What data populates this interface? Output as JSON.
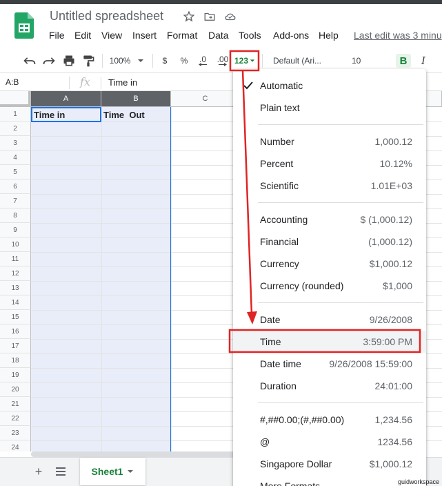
{
  "doc": {
    "title": "Untitled spreadsheet",
    "last_edit": "Last edit was 3 minu"
  },
  "menubar": [
    {
      "label": "File"
    },
    {
      "label": "Edit"
    },
    {
      "label": "View"
    },
    {
      "label": "Insert"
    },
    {
      "label": "Format"
    },
    {
      "label": "Data"
    },
    {
      "label": "Tools"
    },
    {
      "label": "Add-ons"
    },
    {
      "label": "Help"
    }
  ],
  "toolbar": {
    "zoom": "100%",
    "currency": "$",
    "percent": "%",
    "dec_decrease": ".0",
    "dec_increase": ".00",
    "more_formats": "123",
    "font": "Default (Ari...",
    "font_size": "10",
    "bold": "B",
    "italic": "I"
  },
  "formula_bar": {
    "name_box": "A:B",
    "fx": "fx",
    "value": "Time in"
  },
  "grid": {
    "columns": [
      "A",
      "B",
      "C"
    ],
    "rows": [
      "1",
      "2",
      "3",
      "4",
      "5",
      "6",
      "7",
      "8",
      "9",
      "10",
      "11",
      "12",
      "13",
      "14",
      "15",
      "16",
      "17",
      "18",
      "19",
      "20",
      "21",
      "22",
      "23",
      "24"
    ],
    "cells": {
      "A1": "Time in",
      "B1": "Time  Out"
    }
  },
  "format_menu": {
    "automatic": "Automatic",
    "plain_text": "Plain text",
    "items": [
      {
        "label": "Number",
        "example": "1,000.12"
      },
      {
        "label": "Percent",
        "example": "10.12%"
      },
      {
        "label": "Scientific",
        "example": "1.01E+03"
      },
      {
        "label": "Accounting",
        "example": "$ (1,000.12)"
      },
      {
        "label": "Financial",
        "example": "(1,000.12)"
      },
      {
        "label": "Currency",
        "example": "$1,000.12"
      },
      {
        "label": "Currency (rounded)",
        "example": "$1,000"
      },
      {
        "label": "Date",
        "example": "9/26/2008"
      },
      {
        "label": "Time",
        "example": "3:59:00 PM"
      },
      {
        "label": "Date time",
        "example": "9/26/2008 15:59:00"
      },
      {
        "label": "Duration",
        "example": "24:01:00"
      },
      {
        "label": "#,##0.00;(#,##0.00)",
        "example": "1,234.56"
      },
      {
        "label": "@",
        "example": "1234.56"
      },
      {
        "label": "Singapore Dollar",
        "example": "$1,000.12"
      },
      {
        "label": "More Formats",
        "example": ""
      }
    ]
  },
  "sheets": [
    {
      "label": "Sheet1"
    }
  ],
  "watermark": "guidworkspace",
  "colors": {
    "accent_green": "#188038",
    "annotation_red": "#e02424",
    "selection_blue": "#1a73e8"
  }
}
